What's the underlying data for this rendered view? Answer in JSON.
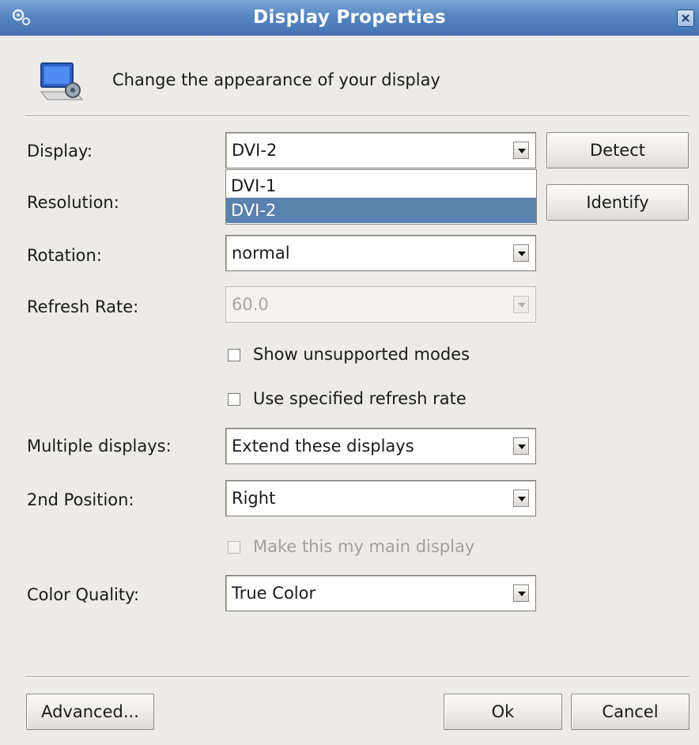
{
  "window": {
    "title": "Display Properties"
  },
  "header": {
    "text": "Change the appearance of your display"
  },
  "form": {
    "display_label": "Display:",
    "display_value": "DVI-2",
    "display_options": [
      "DVI-1",
      "DVI-2"
    ],
    "display_selected_option": "DVI-2",
    "resolution_label": "Resolution:",
    "rotation_label": "Rotation:",
    "rotation_value": "normal",
    "refresh_label": "Refresh Rate:",
    "refresh_value": "60.0",
    "refresh_disabled": true,
    "show_unsupported_label": "Show unsupported modes",
    "show_unsupported_checked": false,
    "use_refresh_label": "Use specified refresh rate",
    "use_refresh_checked": false,
    "multiple_label": "Multiple displays:",
    "multiple_value": "Extend these displays",
    "position_label": "2nd Position:",
    "position_value": "Right",
    "main_display_label": "Make this my main display",
    "main_display_checked": false,
    "main_display_disabled": true,
    "color_label": "Color Quality:",
    "color_value": "True Color"
  },
  "buttons": {
    "detect": "Detect",
    "identify": "Identify",
    "advanced": "Advanced...",
    "ok": "Ok",
    "cancel": "Cancel"
  },
  "colors": {
    "titlebar": "#5484c0",
    "selection": "#5a82af",
    "background": "#edebe8"
  },
  "icons": {
    "window": "gears-icon",
    "header": "monitor-settings-icon",
    "close": "close-icon",
    "combo_arrow": "chevron-down-icon"
  }
}
